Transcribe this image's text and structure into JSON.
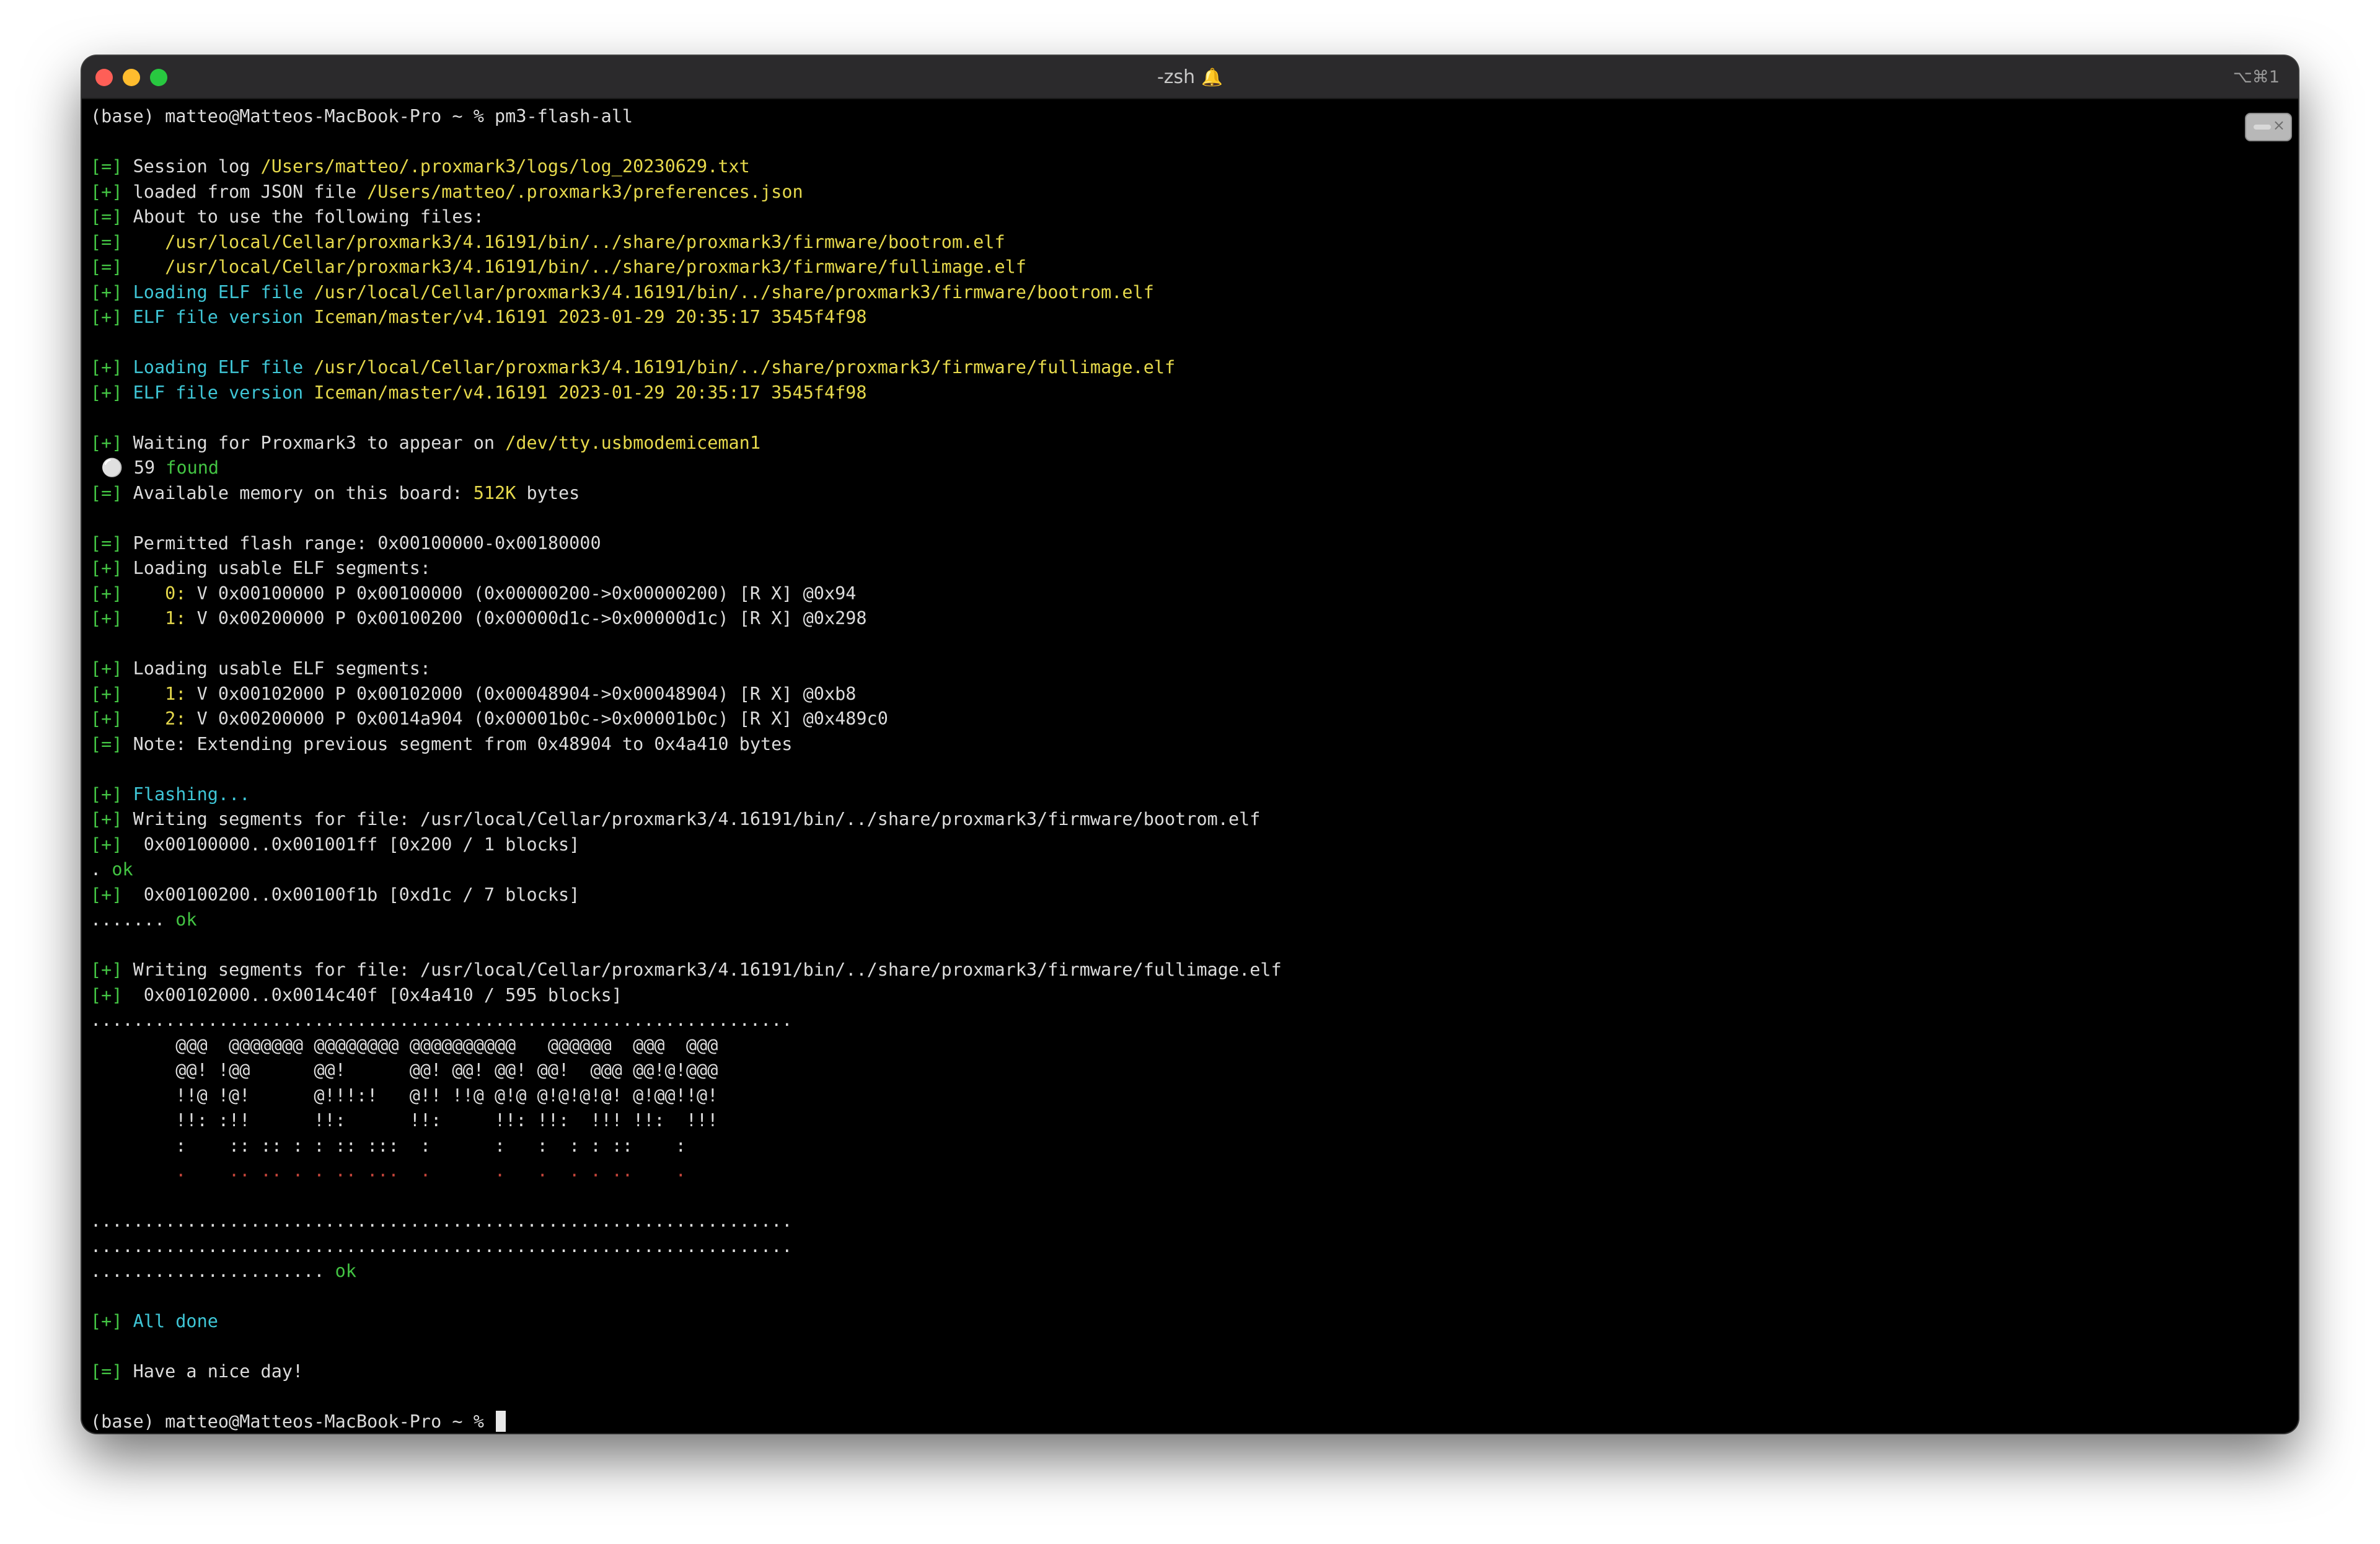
{
  "window": {
    "title": "-zsh",
    "bell_icon": "bell-icon",
    "shortcut": "⌥⌘1",
    "scroll_icon": "scroll-to-bottom-icon"
  },
  "terminal": {
    "lines": [
      [
        {
          "t": "(base) matteo@Matteos-MacBook-Pro ~ % pm3-flash-all",
          "c": "p"
        }
      ],
      [],
      [
        {
          "t": "[=] ",
          "c": "g"
        },
        {
          "t": "Session log ",
          "c": "p"
        },
        {
          "t": "/Users/matteo/.proxmark3/logs/log_20230629.txt",
          "c": "y"
        }
      ],
      [
        {
          "t": "[+] ",
          "c": "g"
        },
        {
          "t": "loaded from JSON file ",
          "c": "p"
        },
        {
          "t": "/Users/matteo/.proxmark3/preferences.json",
          "c": "y"
        }
      ],
      [
        {
          "t": "[=] ",
          "c": "g"
        },
        {
          "t": "About to use the following files:",
          "c": "p"
        }
      ],
      [
        {
          "t": "[=]    ",
          "c": "g"
        },
        {
          "t": "/usr/local/Cellar/proxmark3/4.16191/bin/../share/proxmark3/firmware/bootrom.elf",
          "c": "y"
        }
      ],
      [
        {
          "t": "[=]    ",
          "c": "g"
        },
        {
          "t": "/usr/local/Cellar/proxmark3/4.16191/bin/../share/proxmark3/firmware/fullimage.elf",
          "c": "y"
        }
      ],
      [
        {
          "t": "[+] ",
          "c": "g"
        },
        {
          "t": "Loading ELF file ",
          "c": "c"
        },
        {
          "t": "/usr/local/Cellar/proxmark3/4.16191/bin/../share/proxmark3/firmware/bootrom.elf",
          "c": "y"
        }
      ],
      [
        {
          "t": "[+] ",
          "c": "g"
        },
        {
          "t": "ELF file version ",
          "c": "c"
        },
        {
          "t": "Iceman/master/v4.16191 2023-01-29 20:35:17 3545f4f98",
          "c": "y"
        }
      ],
      [],
      [
        {
          "t": "[+] ",
          "c": "g"
        },
        {
          "t": "Loading ELF file ",
          "c": "c"
        },
        {
          "t": "/usr/local/Cellar/proxmark3/4.16191/bin/../share/proxmark3/firmware/fullimage.elf",
          "c": "y"
        }
      ],
      [
        {
          "t": "[+] ",
          "c": "g"
        },
        {
          "t": "ELF file version ",
          "c": "c"
        },
        {
          "t": "Iceman/master/v4.16191 2023-01-29 20:35:17 3545f4f98",
          "c": "y"
        }
      ],
      [],
      [
        {
          "t": "[+] ",
          "c": "g"
        },
        {
          "t": "Waiting for Proxmark3 to appear on ",
          "c": "p"
        },
        {
          "t": "/dev/tty.usbmodemiceman1",
          "c": "y"
        }
      ],
      [
        {
          "t": " ⚪ ",
          "c": "x"
        },
        {
          "t": "59 ",
          "c": "p"
        },
        {
          "t": "found",
          "c": "g"
        }
      ],
      [
        {
          "t": "[=] ",
          "c": "g"
        },
        {
          "t": "Available memory on this board: ",
          "c": "p"
        },
        {
          "t": "512K",
          "c": "y"
        },
        {
          "t": " bytes",
          "c": "p"
        }
      ],
      [],
      [
        {
          "t": "[=] ",
          "c": "g"
        },
        {
          "t": "Permitted flash range: 0x00100000-0x00180000",
          "c": "p"
        }
      ],
      [
        {
          "t": "[+] ",
          "c": "g"
        },
        {
          "t": "Loading usable ELF segments:",
          "c": "p"
        }
      ],
      [
        {
          "t": "[+]    ",
          "c": "g"
        },
        {
          "t": "0:",
          "c": "y"
        },
        {
          "t": " V 0x00100000 P 0x00100000 (0x00000200->0x00000200) [R X] @0x94",
          "c": "p"
        }
      ],
      [
        {
          "t": "[+]    ",
          "c": "g"
        },
        {
          "t": "1:",
          "c": "y"
        },
        {
          "t": " V 0x00200000 P 0x00100200 (0x00000d1c->0x00000d1c) [R X] @0x298",
          "c": "p"
        }
      ],
      [],
      [
        {
          "t": "[+] ",
          "c": "g"
        },
        {
          "t": "Loading usable ELF segments:",
          "c": "p"
        }
      ],
      [
        {
          "t": "[+]    ",
          "c": "g"
        },
        {
          "t": "1:",
          "c": "y"
        },
        {
          "t": " V 0x00102000 P 0x00102000 (0x00048904->0x00048904) [R X] @0xb8",
          "c": "p"
        }
      ],
      [
        {
          "t": "[+]    ",
          "c": "g"
        },
        {
          "t": "2:",
          "c": "y"
        },
        {
          "t": " V 0x00200000 P 0x0014a904 (0x00001b0c->0x00001b0c) [R X] @0x489c0",
          "c": "p"
        }
      ],
      [
        {
          "t": "[=] ",
          "c": "g"
        },
        {
          "t": "Note: Extending previous segment from 0x48904 to 0x4a410 bytes",
          "c": "p"
        }
      ],
      [],
      [
        {
          "t": "[+] ",
          "c": "g"
        },
        {
          "t": "Flashing...",
          "c": "c"
        }
      ],
      [
        {
          "t": "[+] ",
          "c": "g"
        },
        {
          "t": "Writing segments for file: /usr/local/Cellar/proxmark3/4.16191/bin/../share/proxmark3/firmware/bootrom.elf",
          "c": "p"
        }
      ],
      [
        {
          "t": "[+]  ",
          "c": "g"
        },
        {
          "t": "0x00100000..0x001001ff [0x200 / 1 blocks]",
          "c": "p"
        }
      ],
      [
        {
          "t": ". ",
          "c": "p"
        },
        {
          "t": "ok",
          "c": "g"
        }
      ],
      [
        {
          "t": "[+]  ",
          "c": "g"
        },
        {
          "t": "0x00100200..0x00100f1b [0xd1c / 7 blocks]",
          "c": "p"
        }
      ],
      [
        {
          "t": "....... ",
          "c": "p"
        },
        {
          "t": "ok",
          "c": "g"
        }
      ],
      [],
      [
        {
          "t": "[+] ",
          "c": "g"
        },
        {
          "t": "Writing segments for file: /usr/local/Cellar/proxmark3/4.16191/bin/../share/proxmark3/firmware/fullimage.elf",
          "c": "p"
        }
      ],
      [
        {
          "t": "[+]  ",
          "c": "g"
        },
        {
          "t": "0x00102000..0x0014c40f [0x4a410 / 595 blocks]",
          "c": "p"
        }
      ],
      [
        {
          "t": "..................................................................",
          "c": "p"
        }
      ],
      [
        {
          "t": "        @@@  @@@@@@@ @@@@@@@@ @@@@@@@@@@   @@@@@@  @@@  @@@",
          "c": "p"
        }
      ],
      [
        {
          "t": "        @@! !@@      @@!      @@! @@! @@! @@!  @@@ @@!@!@@@",
          "c": "p"
        }
      ],
      [
        {
          "t": "        !!@ !@!      @!!!:!   @!! !!@ @!@ @!@!@!@! @!@@!!@!",
          "c": "p"
        }
      ],
      [
        {
          "t": "        !!: :!!      !!:      !!:     !!: !!:  !!! !!:  !!!",
          "c": "p"
        }
      ],
      [
        {
          "t": "        :    :: :: : : :: :::  :      :   :  : : ::    :",
          "c": "p"
        }
      ],
      [
        {
          "t": "        .    .. .. . . .. ...  .      .   .  . . ..    .",
          "c": "r"
        }
      ],
      [],
      [
        {
          "t": "..................................................................",
          "c": "p"
        }
      ],
      [
        {
          "t": "..................................................................",
          "c": "p"
        }
      ],
      [
        {
          "t": "...................... ",
          "c": "p"
        },
        {
          "t": "ok",
          "c": "g"
        }
      ],
      [],
      [
        {
          "t": "[+] ",
          "c": "g"
        },
        {
          "t": "All done",
          "c": "c"
        }
      ],
      [],
      [
        {
          "t": "[=] ",
          "c": "g"
        },
        {
          "t": "Have a nice day!",
          "c": "p"
        }
      ],
      [],
      [
        {
          "t": "(base) matteo@Matteos-MacBook-Pro ~ % ",
          "c": "p"
        }
      ]
    ]
  }
}
